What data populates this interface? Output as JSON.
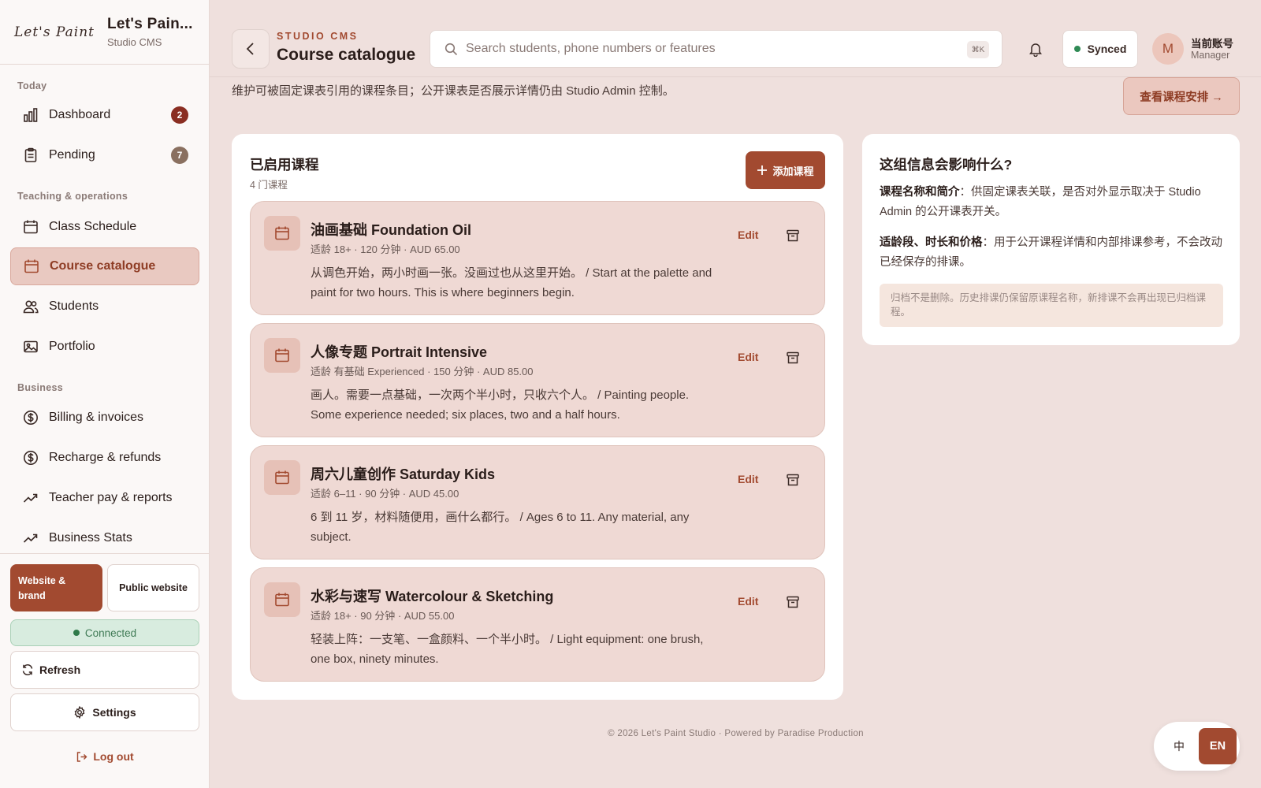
{
  "brand": {
    "logo_text": "Let's Paint",
    "name": "Let's Pain...",
    "subtitle": "Studio CMS"
  },
  "sidebar": {
    "sections": [
      "Today",
      "Teaching & operations",
      "Business"
    ],
    "items": [
      {
        "label": "Dashboard",
        "icon": "bar-chart-icon",
        "badge": "2",
        "badge_color": "#8a2e22"
      },
      {
        "label": "Pending",
        "icon": "clipboard-icon",
        "badge": "7",
        "badge_color": "#8a7060"
      },
      {
        "label": "Class Schedule",
        "icon": "calendar-icon"
      },
      {
        "label": "Course catalogue",
        "icon": "calendar-icon",
        "active": true
      },
      {
        "label": "Students",
        "icon": "users-icon"
      },
      {
        "label": "Portfolio",
        "icon": "image-icon"
      },
      {
        "label": "Billing & invoices",
        "icon": "dollar-icon"
      },
      {
        "label": "Recharge & refunds",
        "icon": "dollar-icon"
      },
      {
        "label": "Teacher pay & reports",
        "icon": "trend-icon"
      },
      {
        "label": "Business Stats",
        "icon": "trend-icon"
      }
    ],
    "website_brand": "Website & brand",
    "public_website": "Public website",
    "connected": "Connected",
    "refresh": "Refresh",
    "settings": "Settings",
    "logout": "Log out"
  },
  "header": {
    "eyebrow": "STUDIO CMS",
    "title": "Course catalogue",
    "search_placeholder": "Search students, phone numbers or features",
    "search_shortcut": "⌘K",
    "sync_status": "Synced",
    "account": {
      "initial": "M",
      "name": "当前账号",
      "role": "Manager"
    }
  },
  "page": {
    "description": "维护可被固定课表引用的课程条目；公开课表是否展示详情仍由 Studio Admin 控制。",
    "schedule_button": "查看课程安排 →"
  },
  "courses_card": {
    "title": "已启用课程",
    "count": "4 门课程",
    "add_button": "添加课程",
    "edit_label": "Edit",
    "courses": [
      {
        "title": "油画基础 Foundation Oil",
        "meta": "适龄 18+ · 120 分钟 · AUD 65.00",
        "desc": "从调色开始，两小时画一张。没画过也从这里开始。 / Start at the palette and paint for two hours. This is where beginners begin."
      },
      {
        "title": "人像专题 Portrait Intensive",
        "meta": "适龄 有基础 Experienced · 150 分钟 · AUD 85.00",
        "desc": "画人。需要一点基础，一次两个半小时，只收六个人。 / Painting people. Some experience needed; six places, two and a half hours."
      },
      {
        "title": "周六儿童创作 Saturday Kids",
        "meta": "适龄 6–11 · 90 分钟 · AUD 45.00",
        "desc": "6 到 11 岁，材料随便用，画什么都行。 / Ages 6 to 11. Any material, any subject."
      },
      {
        "title": "水彩与速写 Watercolour & Sketching",
        "meta": "适龄 18+ · 90 分钟 · AUD 55.00",
        "desc": "轻装上阵：一支笔、一盒颜料、一个半小时。 / Light equipment: one brush, one box, ninety minutes."
      }
    ]
  },
  "info_card": {
    "title": "这组信息会影响什么?",
    "p1_label": "课程名称和简介",
    "p1_text": "：供固定课表关联，是否对外显示取决于 Studio Admin 的公开课表开关。",
    "p2_label": "适龄段、时长和价格",
    "p2_text": "：用于公开课程详情和内部排课参考，不会改动已经保存的排课。",
    "note": "归档不是删除。历史排课仍保留原课程名称，新排课不会再出现已归档课程。"
  },
  "footer": "© 2026 Let's Paint Studio · Powered by Paradise Production",
  "lang": {
    "zh": "中",
    "en": "EN"
  },
  "colors": {
    "accent": "#a24a30",
    "background": "#efe0dd",
    "course_bg": "#efd9d4",
    "connected": "#2f7a4a"
  }
}
